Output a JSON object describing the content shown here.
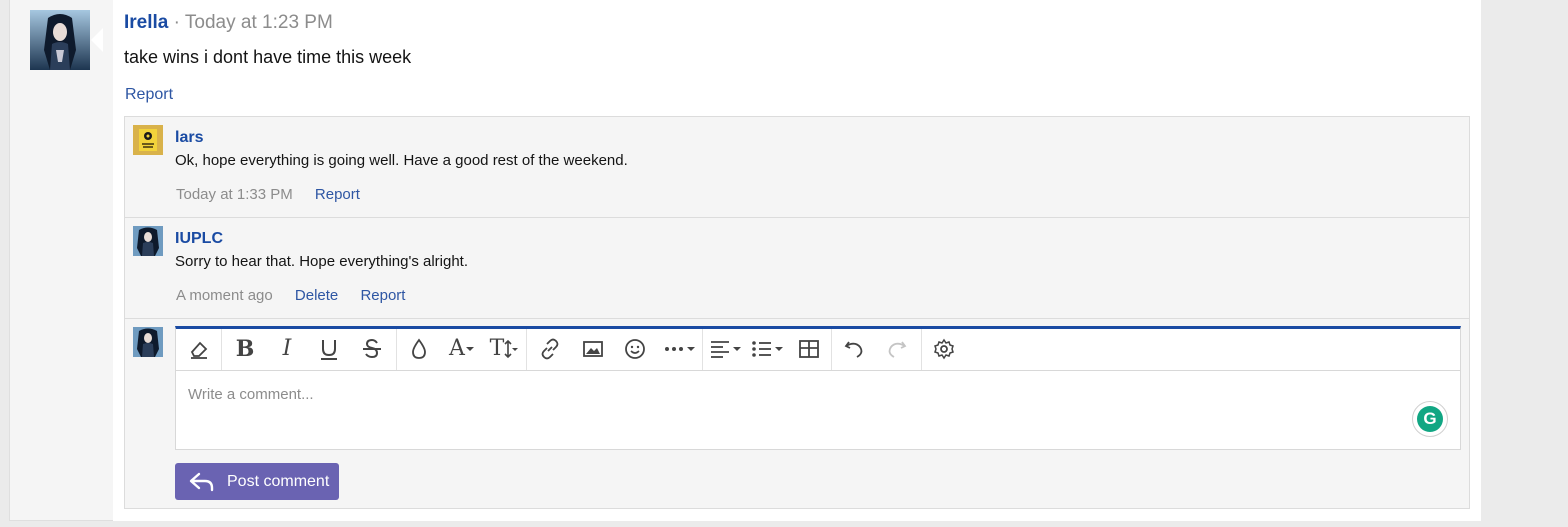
{
  "post": {
    "author": "Irella",
    "separator": "·",
    "time": "Today at 1:23 PM",
    "body": "take wins i dont have time this week",
    "report_label": "Report"
  },
  "comments": [
    {
      "author": "lars",
      "text": "Ok, hope everything is going well. Have a good rest of the weekend.",
      "time": "Today at 1:33 PM",
      "actions": [
        "Report"
      ]
    },
    {
      "author": "IUPLC",
      "text": "Sorry to hear that. Hope everything's alright.",
      "time": "A moment ago",
      "actions": [
        "Delete",
        "Report"
      ]
    }
  ],
  "editor": {
    "placeholder": "Write a comment...",
    "toolbar_icons": [
      "eraser-icon",
      "bold-icon",
      "italic-icon",
      "underline-icon",
      "strikethrough-icon",
      "color-icon",
      "font-family-icon",
      "font-size-icon",
      "link-icon",
      "image-icon",
      "emoji-icon",
      "more-icon",
      "align-icon",
      "list-icon",
      "table-icon",
      "undo-icon",
      "redo-icon",
      "settings-icon"
    ],
    "grammarly_letter": "G",
    "submit_label": "Post comment"
  },
  "colors": {
    "link": "#2e56a3",
    "username": "#1a4ba3",
    "button": "#6a63b2",
    "editor_accent": "#1a4ba3"
  }
}
